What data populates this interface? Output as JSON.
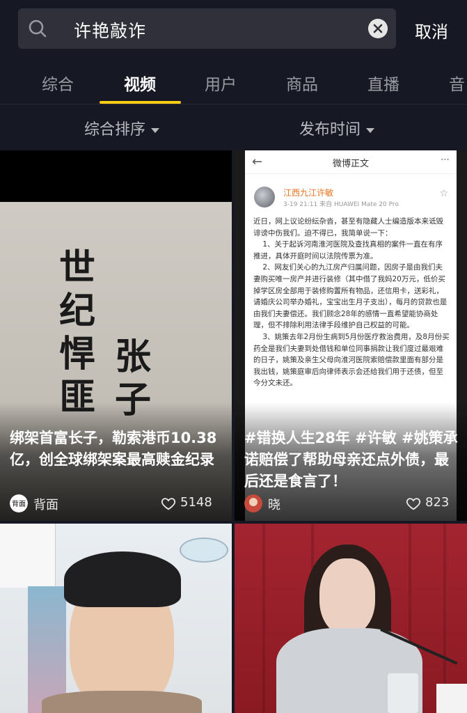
{
  "search": {
    "query": "许艳敲诈",
    "cancel_label": "取消"
  },
  "tabs": [
    {
      "label": "综合"
    },
    {
      "label": "视频",
      "active": true
    },
    {
      "label": "用户"
    },
    {
      "label": "商品"
    },
    {
      "label": "直播"
    },
    {
      "label": "音"
    }
  ],
  "filters": {
    "sort_label": "综合排序",
    "time_label": "发布时间"
  },
  "colors": {
    "background": "#161823",
    "accent": "#face15",
    "search_bg": "#2f3039"
  },
  "videos": [
    {
      "cover_text": [
        "世",
        "纪",
        "悍",
        "匪",
        "张",
        "子"
      ],
      "caption": "绑架首富长子，勒索港币10.38亿，创全球绑架案最高赎金纪录",
      "author": "背面",
      "author_avatar_text": "背面",
      "likes": "5148"
    },
    {
      "weibo": {
        "header_title": "微博正文",
        "user_name": "江西九江许敏",
        "meta": "3-19 21:11  来自 HUAWEI Mate 20 Pro",
        "body": "近日，网上议论纷纭杂沓，甚至有隐藏人士编造版本来诋毁诽谤中伤我们。迫不得已，我简单说一下：\n    1、关于起诉河南淮河医院及查找真相的案件一直在有序推进，具体开庭时间以法院传票为准。\n    2、网友们关心的九江房产归属问题，因房子是由我们夫妻购买唯一房产并进行装修（其中借了我妈20万元，低价买掉学区房全部用于装修购置所有物品，还信用卡，送彩礼，请婚庆公司举办婚礼，宝宝出生月子支出），每月的贷款也是由我们夫妻偿还。我们顾念28年的感情一直希望能协商处理，但不排除利用法律手段维护自己权益的可能。\n    3、姚策去年2月份生病到5月份医疗救治费用，及8月份买药全是我们夫妻到处借钱和单位同事捐款让我们度过最艰难的日子，姚策及亲生父母向淮河医院索赔偿款里面有部分是我出钱，姚策庭审后向律师表示会还给我们用于还债，但至今分文未还。"
      },
      "caption": "#错换人生28年 #许敏 #姚策承诺赔偿了帮助母亲还点外债，最后还是食言了！",
      "author": "晓",
      "likes": "823"
    },
    {},
    {}
  ]
}
